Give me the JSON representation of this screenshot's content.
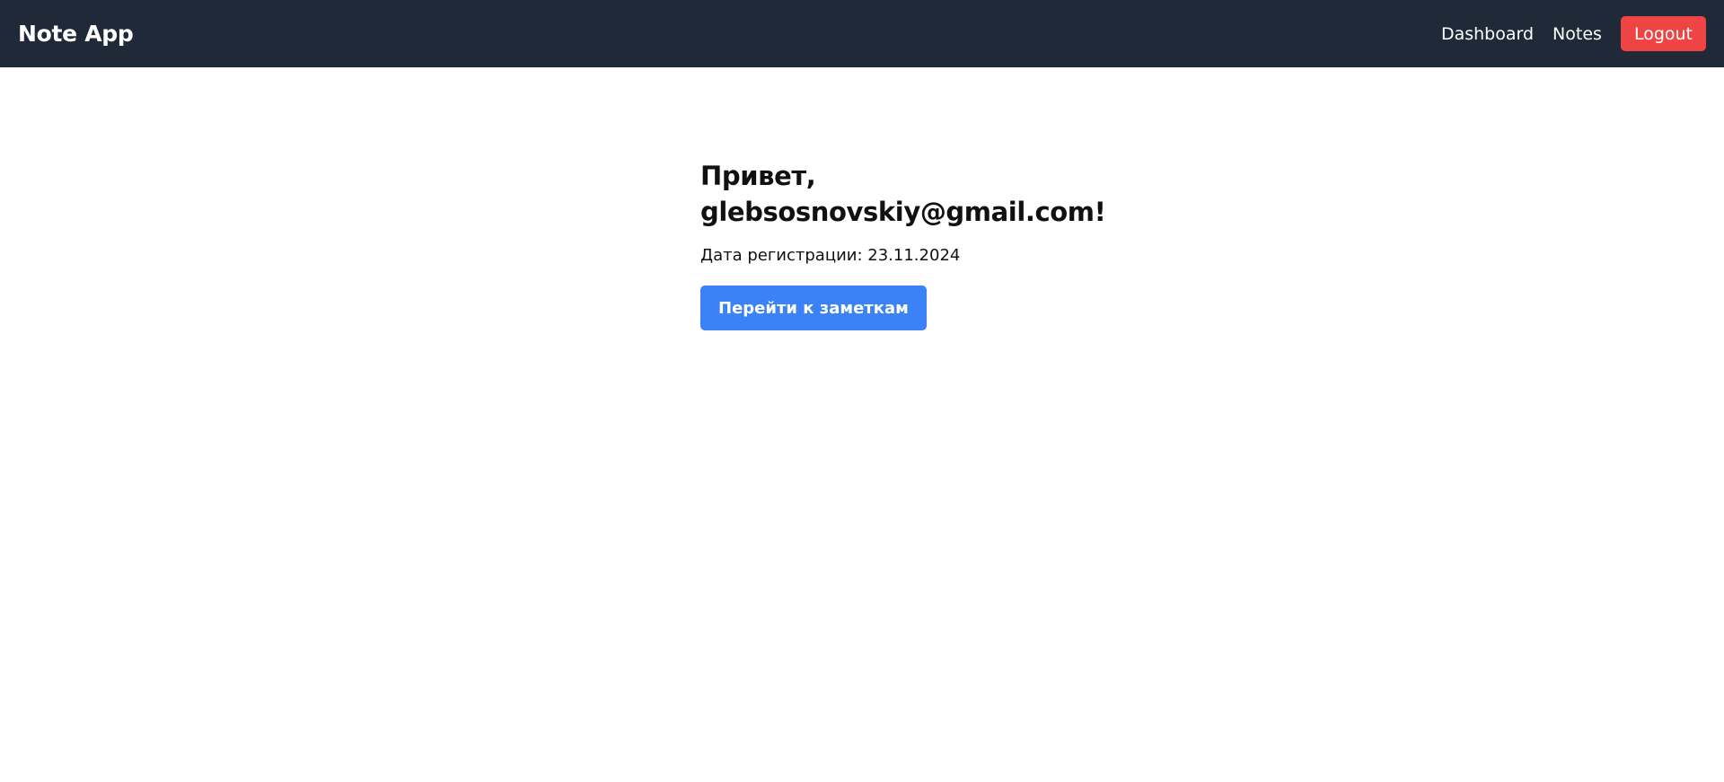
{
  "header": {
    "brand": "Note App",
    "nav": {
      "dashboard_label": "Dashboard",
      "notes_label": "Notes",
      "logout_label": "Logout"
    }
  },
  "main": {
    "greeting_prefix": "Привет,",
    "greeting_email": "glebsosnovskiy@gmail.com!",
    "registration_label": "Дата регистрации:",
    "registration_date": "23.11.2024",
    "go_to_notes_label": "Перейти к заметкам"
  },
  "colors": {
    "navbar_bg": "#1f2937",
    "logout_bg": "#ef4444",
    "primary_button_bg": "#3b82f6"
  }
}
